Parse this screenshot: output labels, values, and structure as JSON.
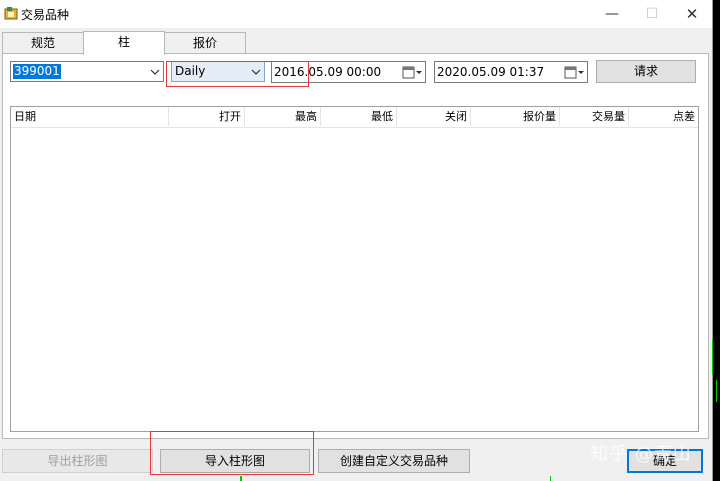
{
  "window": {
    "title": "交易品种",
    "min": "—",
    "max": "☐",
    "close": "✕"
  },
  "tabs": [
    {
      "label": "规范"
    },
    {
      "label": "柱"
    },
    {
      "label": "报价"
    }
  ],
  "filters": {
    "symbol": "399001",
    "period": "Daily",
    "date_from": "2016.05.09 00:00",
    "date_to": "2020.05.09 01:37",
    "request_label": "请求"
  },
  "table": {
    "columns": [
      "日期",
      "打开",
      "最高",
      "最低",
      "关闭",
      "报价量",
      "交易量",
      "点差"
    ]
  },
  "buttons": {
    "export": "导出柱形图",
    "import": "导入柱形图",
    "create_custom": "创建自定义交易品种",
    "ok": "确定"
  },
  "watermark": "知乎 @青山",
  "colors": {
    "accent": "#0078d7",
    "highlight": "#e03a3a"
  }
}
